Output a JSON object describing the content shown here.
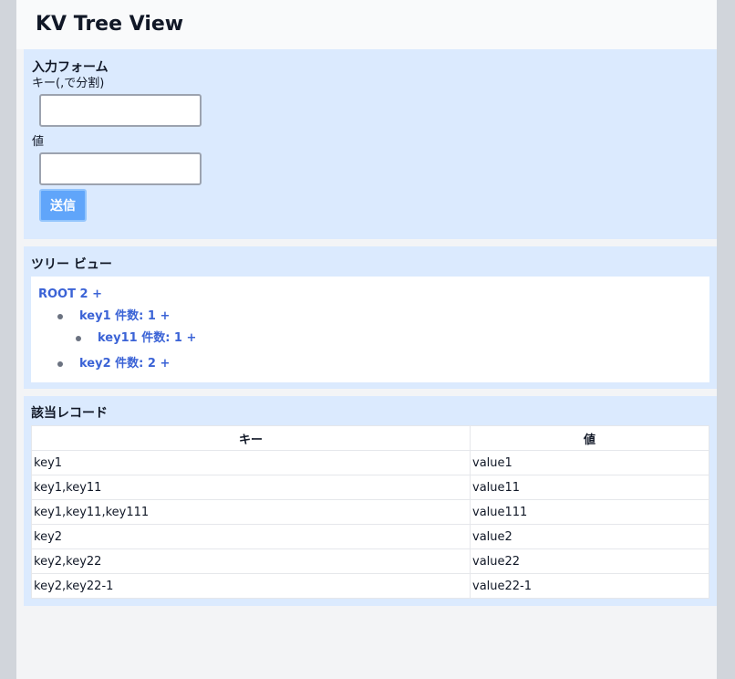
{
  "app": {
    "title": "KV Tree View"
  },
  "form": {
    "title": "入力フォーム",
    "key_label": "キー(,で分割)",
    "key_value": "",
    "value_label": "値",
    "value_value": "",
    "submit_label": "送信"
  },
  "tree": {
    "title": "ツリー ビュー",
    "root": "ROOT 2 +",
    "nodes": [
      {
        "label": "key1 件数: 1 +"
      },
      {
        "label": "key11 件数: 1 +"
      },
      {
        "label": "key2 件数: 2 +"
      }
    ]
  },
  "records": {
    "title": "該当レコード",
    "headers": [
      "キー",
      "値"
    ],
    "rows": [
      [
        "key1",
        "value1"
      ],
      [
        "key1,key11",
        "value11"
      ],
      [
        "key1,key11,key111",
        "value111"
      ],
      [
        "key2",
        "value2"
      ],
      [
        "key2,key22",
        "value22"
      ],
      [
        "key2,key22-1",
        "value22-1"
      ]
    ]
  },
  "colors": {
    "panel": "#dbeafe",
    "link": "#3b63d6",
    "button": "#60a5fa"
  }
}
